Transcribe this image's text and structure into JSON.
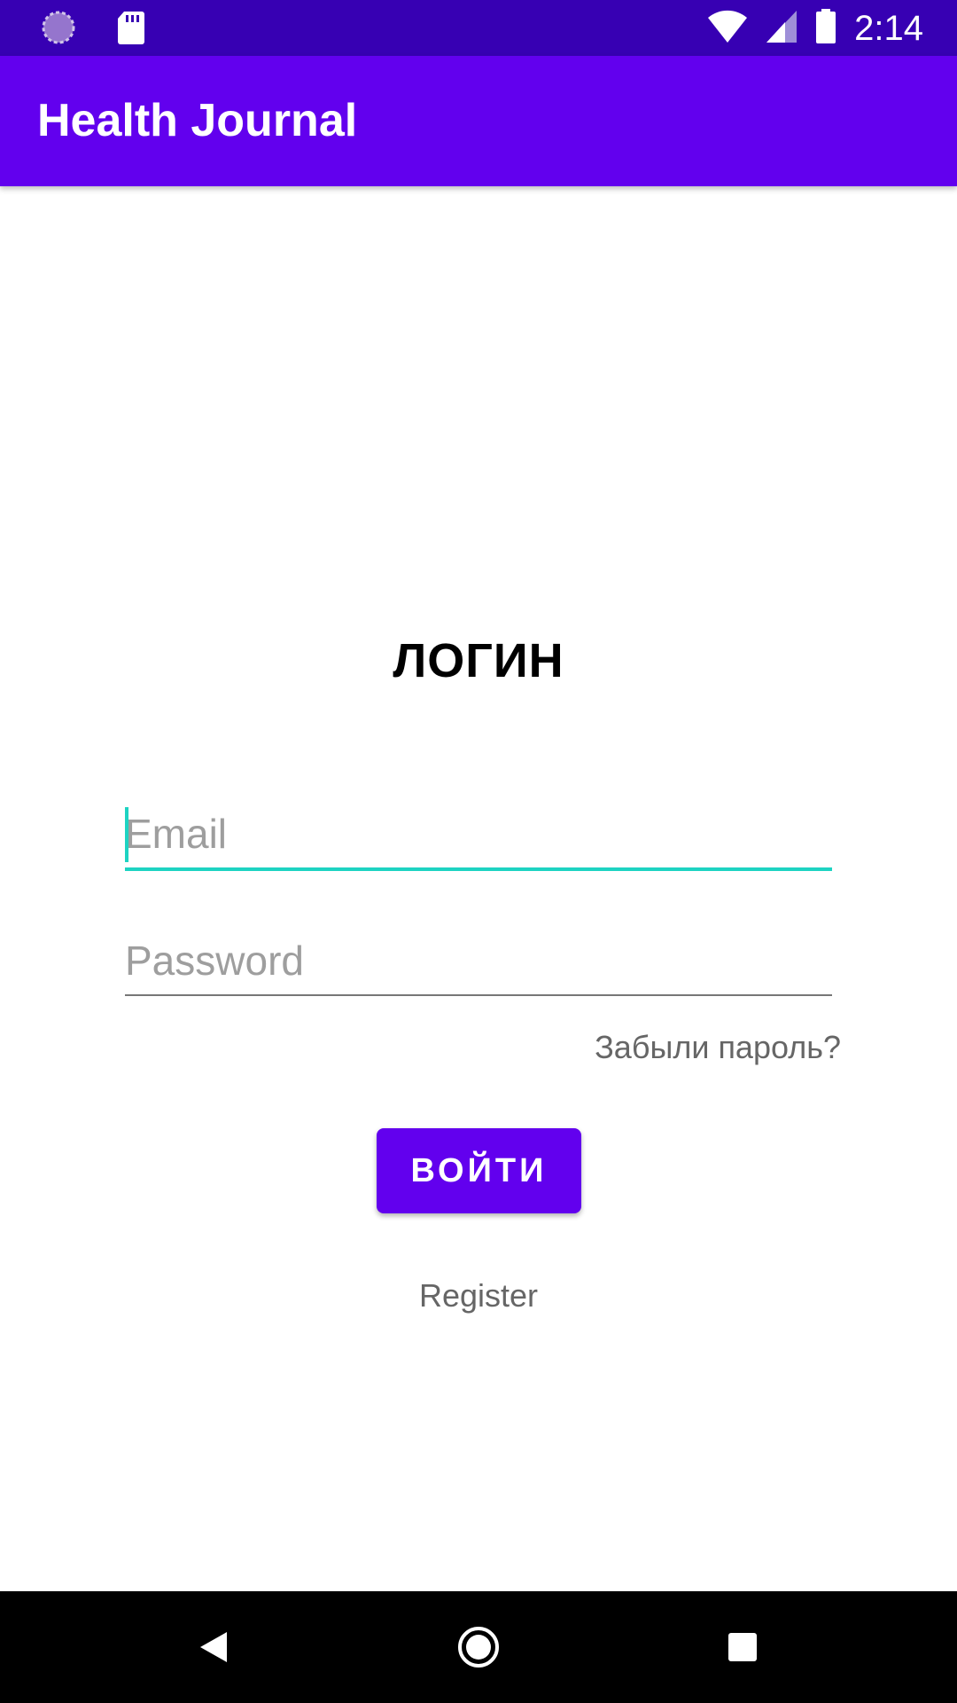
{
  "status_bar": {
    "time": "2:14",
    "icons": [
      "loading-icon",
      "sd-card-icon",
      "wifi-icon",
      "signal-icon",
      "battery-icon"
    ]
  },
  "app_bar": {
    "title": "Health Journal"
  },
  "login": {
    "heading": "ЛОГИН",
    "email_placeholder": "Email",
    "email_value": "",
    "password_placeholder": "Password",
    "password_value": "",
    "forgot_password": "Забыли пароль?",
    "login_button": "ВОЙТИ",
    "register_link": "Register"
  },
  "navigation": {
    "icons": [
      "back-icon",
      "home-icon",
      "recents-icon"
    ]
  },
  "colors": {
    "status_bar": "#3700B3",
    "primary": "#6200EE",
    "accent": "#1DD3C2",
    "secondary_text": "#666666"
  }
}
